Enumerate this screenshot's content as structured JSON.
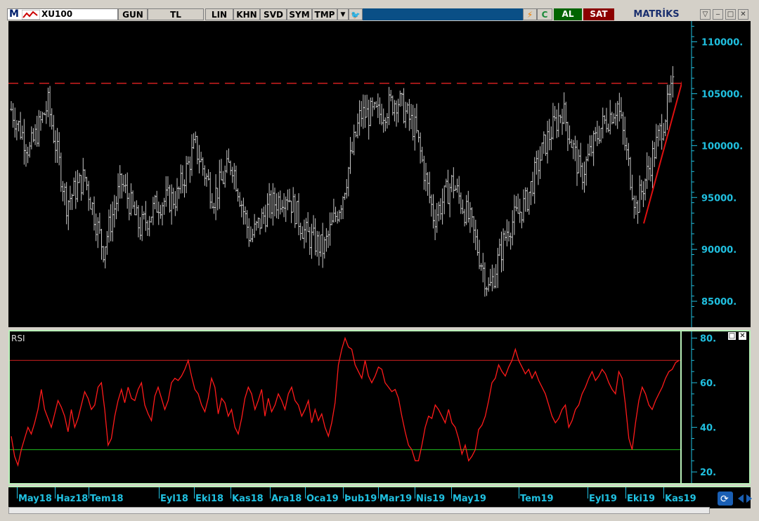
{
  "toolbar": {
    "logo": "M",
    "symbol": "XU100",
    "period": "GUN",
    "currency": "TL",
    "scale": "LIN",
    "buttons": [
      "KHN",
      "SVD",
      "SYM",
      "TMP"
    ],
    "al": "AL",
    "sat": "SAT",
    "brand": "MATRİKS",
    "refresh": "C"
  },
  "rsi_label": "RSI",
  "date_labels": [
    "May18",
    "Haz18",
    "Tem18",
    "Eyl18",
    "Eki18",
    "Kas18",
    "Ara18",
    "Oca19",
    "Þub19",
    "Mar19",
    "Nis19",
    "May19",
    "Tem19",
    "Eyl19",
    "Eki19",
    "Kas19"
  ],
  "colors": {
    "background": "#000000",
    "bars": "#c8c8c8",
    "resistance": "#d42020",
    "trend": "#e01010",
    "rsi_line": "#ff1a1a",
    "rsi_upper": "#d42020",
    "rsi_lower": "#20c020",
    "axis_text": "#20c0e0"
  },
  "chart_data": [
    {
      "type": "ohlc",
      "symbol": "XU100",
      "y_ticks": [
        "110000.",
        "105000.",
        "100000.",
        "95000.",
        "90000.",
        "85000."
      ],
      "ylim": [
        82500,
        112000
      ],
      "resistance_level": 106000,
      "trendline": {
        "from": [
          "Eki19",
          92500
        ],
        "to": [
          "Kas19",
          106500
        ]
      },
      "approx_closes": [
        {
          "x": "May18",
          "y": 103500
        },
        {
          "x": "May18",
          "y": 99500
        },
        {
          "x": "May18",
          "y": 104000
        },
        {
          "x": "Haz18",
          "y": 94500
        },
        {
          "x": "Haz18",
          "y": 97000
        },
        {
          "x": "Tem18",
          "y": 90000
        },
        {
          "x": "Tem18",
          "y": 96500
        },
        {
          "x": "Tem18",
          "y": 92000
        },
        {
          "x": "Tem18",
          "y": 94500
        },
        {
          "x": "Eyl18",
          "y": 95000
        },
        {
          "x": "Eyl18",
          "y": 100000
        },
        {
          "x": "Eki18",
          "y": 95000
        },
        {
          "x": "Eki18",
          "y": 98500
        },
        {
          "x": "Eki18",
          "y": 91000
        },
        {
          "x": "Kas18",
          "y": 94000
        },
        {
          "x": "Kas18",
          "y": 95500
        },
        {
          "x": "Ara18",
          "y": 91500
        },
        {
          "x": "Ara18",
          "y": 90000
        },
        {
          "x": "Oca19",
          "y": 95000
        },
        {
          "x": "Oca19",
          "y": 103000
        },
        {
          "x": "Þub19",
          "y": 103000
        },
        {
          "x": "Þub19",
          "y": 104500
        },
        {
          "x": "Mar19",
          "y": 101500
        },
        {
          "x": "Mar19",
          "y": 93000
        },
        {
          "x": "Nis19",
          "y": 96500
        },
        {
          "x": "Nis19",
          "y": 92500
        },
        {
          "x": "May19",
          "y": 86000
        },
        {
          "x": "May19",
          "y": 92000
        },
        {
          "x": "May19",
          "y": 94500
        },
        {
          "x": "Tem19",
          "y": 100000
        },
        {
          "x": "Tem19",
          "y": 103500
        },
        {
          "x": "Tem19",
          "y": 97000
        },
        {
          "x": "Eyl19",
          "y": 101500
        },
        {
          "x": "Eyl19",
          "y": 104000
        },
        {
          "x": "Eki19",
          "y": 94000
        },
        {
          "x": "Eki19",
          "y": 99500
        },
        {
          "x": "Kas19",
          "y": 105500
        }
      ]
    },
    {
      "type": "line",
      "title": "RSI",
      "y_ticks": [
        "80.",
        "60.",
        "40.",
        "20."
      ],
      "ylim": [
        15,
        83
      ],
      "upper_band": 70,
      "lower_band": 30,
      "values": [
        36,
        27,
        23,
        30,
        35,
        40,
        37,
        42,
        48,
        57,
        48,
        44,
        40,
        46,
        52,
        49,
        45,
        38,
        48,
        40,
        44,
        50,
        56,
        53,
        48,
        50,
        58,
        60,
        48,
        32,
        35,
        45,
        52,
        57,
        51,
        58,
        53,
        52,
        57,
        60,
        50,
        46,
        43,
        54,
        58,
        53,
        48,
        52,
        60,
        62,
        61,
        63,
        66,
        70,
        63,
        57,
        55,
        50,
        47,
        53,
        62,
        58,
        46,
        53,
        51,
        45,
        48,
        40,
        37,
        44,
        53,
        58,
        55,
        48,
        52,
        57,
        45,
        53,
        47,
        50,
        55,
        52,
        48,
        55,
        58,
        52,
        50,
        45,
        48,
        52,
        42,
        48,
        43,
        46,
        40,
        36,
        42,
        51,
        68,
        75,
        80,
        76,
        75,
        68,
        65,
        62,
        70,
        63,
        60,
        63,
        67,
        66,
        60,
        58,
        56,
        57,
        53,
        45,
        38,
        32,
        30,
        25,
        25,
        32,
        40,
        45,
        44,
        50,
        48,
        45,
        42,
        48,
        42,
        40,
        35,
        28,
        32,
        25,
        27,
        30,
        39,
        41,
        45,
        52,
        60,
        62,
        68,
        65,
        63,
        67,
        70,
        75,
        70,
        67,
        64,
        66,
        62,
        65,
        61,
        58,
        55,
        50,
        45,
        42,
        44,
        48,
        50,
        40,
        43,
        48,
        50,
        55,
        58,
        62,
        65,
        61,
        63,
        66,
        64,
        60,
        57,
        55,
        65,
        62,
        50,
        35,
        30,
        42,
        52,
        58,
        55,
        50,
        48,
        52,
        55,
        58,
        62,
        65,
        66,
        69,
        70
      ]
    }
  ]
}
